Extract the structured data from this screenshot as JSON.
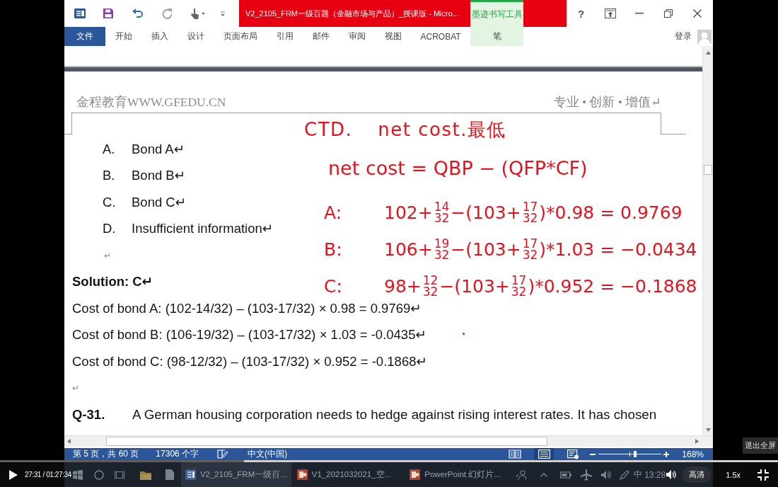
{
  "window": {
    "title": "V2_2105_FRM一级百题（金融市场与产品）_授课版 - Micro...",
    "context_tab": "墨迹书写工具",
    "help": "?"
  },
  "ribbon": {
    "tabs": [
      {
        "label": "文件",
        "kind": "file"
      },
      {
        "label": "开始",
        "kind": "tab"
      },
      {
        "label": "插入",
        "kind": "tab"
      },
      {
        "label": "设计",
        "kind": "tab"
      },
      {
        "label": "页面布局",
        "kind": "tab"
      },
      {
        "label": "引用",
        "kind": "tab"
      },
      {
        "label": "邮件",
        "kind": "tab"
      },
      {
        "label": "审阅",
        "kind": "tab"
      },
      {
        "label": "视图",
        "kind": "tab"
      },
      {
        "label": "ACROBAT",
        "kind": "tab"
      },
      {
        "label": "笔",
        "kind": "context"
      }
    ],
    "sign_in": "登录"
  },
  "document": {
    "header": {
      "left": "金程教育WWW.GFEDU.CN",
      "right": "专业 • 创新 • 增值↵"
    },
    "blocks": [
      {
        "kind": "option",
        "letter": "A.",
        "text": "Bond A↵"
      },
      {
        "kind": "option",
        "letter": "B.",
        "text": "Bond B↵"
      },
      {
        "kind": "option",
        "letter": "C.",
        "text": "Bond C↵"
      },
      {
        "kind": "option",
        "letter": "D.",
        "text": "Insufficient information↵"
      },
      {
        "kind": "option_mark",
        "text": "↵"
      },
      {
        "kind": "bold",
        "text": "Solution: C↵"
      },
      {
        "kind": "text",
        "text": "Cost of bond A: (102-14/32) – (103-17/32) × 0.98 = 0.9769↵"
      },
      {
        "kind": "text",
        "text": "Cost of bond B: (106-19/32) – (103-17/32) × 1.03 = -0.0435↵"
      },
      {
        "kind": "text",
        "text": "Cost of bond C: (98-12/32) – (103-17/32) × 0.952 = -0.1868↵"
      },
      {
        "kind": "mark",
        "text": "↵"
      },
      {
        "kind": "question",
        "number": "Q-31.",
        "text": "A German housing corporation needs to hedge against rising interest rates. It has chosen"
      }
    ]
  },
  "ink": {
    "lines": [
      {
        "kind": "title",
        "segments": [
          {
            "kind": "text",
            "text": "CTD."
          },
          {
            "kind": "text",
            "text": "net cost.最低"
          }
        ]
      },
      {
        "kind": "formula",
        "segments": [
          {
            "kind": "text",
            "text": "net cost = QBP − (QFP*CF)"
          }
        ]
      },
      {
        "kind": "calc",
        "label": "A:",
        "segments": [
          {
            "kind": "text",
            "text": "102+"
          },
          {
            "kind": "frac",
            "num": "14",
            "den": "32"
          },
          {
            "kind": "text",
            "text": " −(103+"
          },
          {
            "kind": "frac",
            "num": "17",
            "den": "32"
          },
          {
            "kind": "text",
            "text": ")*0.98 = 0.9769"
          }
        ]
      },
      {
        "kind": "calc",
        "label": "B:",
        "segments": [
          {
            "kind": "text",
            "text": "106+"
          },
          {
            "kind": "frac",
            "num": "19",
            "den": "32"
          },
          {
            "kind": "text",
            "text": " −(103+"
          },
          {
            "kind": "frac",
            "num": "17",
            "den": "32"
          },
          {
            "kind": "text",
            "text": ")*1.03 = −0.0434"
          }
        ]
      },
      {
        "kind": "calc",
        "label": "C:",
        "segments": [
          {
            "kind": "text",
            "text": "98+"
          },
          {
            "kind": "frac",
            "num": "12",
            "den": "32"
          },
          {
            "kind": "text",
            "text": " −(103+"
          },
          {
            "kind": "frac",
            "num": "17",
            "den": "32"
          },
          {
            "kind": "text",
            "text": ")*0.952 = −0.1868"
          }
        ]
      }
    ]
  },
  "status_bar": {
    "page": "第 5 页，共 60 页",
    "words": "17306 个字",
    "language": "中文(中国)",
    "views": [
      {
        "kind": "read",
        "selected": false
      },
      {
        "kind": "print",
        "selected": true
      },
      {
        "kind": "web",
        "selected": false
      }
    ],
    "zoom": {
      "level": 0.58,
      "reading": "168%"
    }
  },
  "taskbar": {
    "apps": [
      {
        "kind": "word",
        "label": "V2_2105_FRM一级百...",
        "selected": true
      },
      {
        "kind": "powerpoint",
        "label": "V1_2021032021_空...",
        "selected": false
      },
      {
        "kind": "powerpoint",
        "label": "PowerPoint 幻灯片...",
        "selected": false
      }
    ],
    "input_method": "中",
    "clock": "13:28"
  },
  "player": {
    "time": "27:31 / 01:27:34",
    "progress": {
      "level": 0.314
    },
    "quality": "高清",
    "speed": "1.5x",
    "tooltip": "退出全屏"
  }
}
